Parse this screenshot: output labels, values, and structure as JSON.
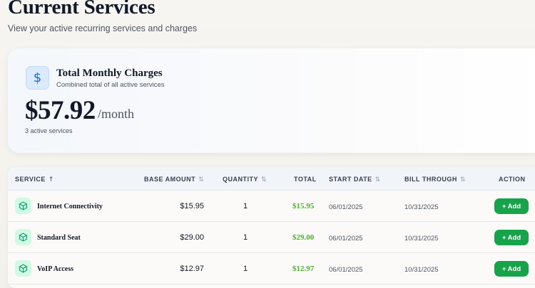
{
  "header": {
    "title": "Current Services",
    "subtitle": "View your active recurring services and charges"
  },
  "summary": {
    "icon": "dollar-icon",
    "icon_glyph": "$",
    "heading": "Total Monthly Charges",
    "description": "Combined total of all active services",
    "amount": "$57.92",
    "period": "/month",
    "count_text": "3 active services"
  },
  "table": {
    "columns": {
      "service": "SERVICE",
      "base_amount": "BASE AMOUNT",
      "quantity": "QUANTITY",
      "total": "TOTAL",
      "start_date": "START DATE",
      "bill_through": "BILL THROUGH",
      "action": "ACTION"
    },
    "sort_glyphs": {
      "asc": "↑",
      "both": "⇅"
    },
    "rows": [
      {
        "service": "Internet Connectivity",
        "base_amount": "$15.95",
        "quantity": "1",
        "total": "$15.95",
        "start_date": "06/01/2025",
        "bill_through": "10/31/2025",
        "action": "+ Add"
      },
      {
        "service": "Standard Seat",
        "base_amount": "$29.00",
        "quantity": "1",
        "total": "$29.00",
        "start_date": "06/01/2025",
        "bill_through": "10/31/2025",
        "action": "+ Add"
      },
      {
        "service": "VoIP Access",
        "base_amount": "$12.97",
        "quantity": "1",
        "total": "$12.97",
        "start_date": "06/01/2025",
        "bill_through": "10/31/2025",
        "action": "+ Add"
      }
    ]
  },
  "colors": {
    "accent_blue": "#2563eb",
    "total_green": "#4caf2f",
    "button_green": "#16a34a",
    "icon_green_bg": "#d1fae5"
  }
}
